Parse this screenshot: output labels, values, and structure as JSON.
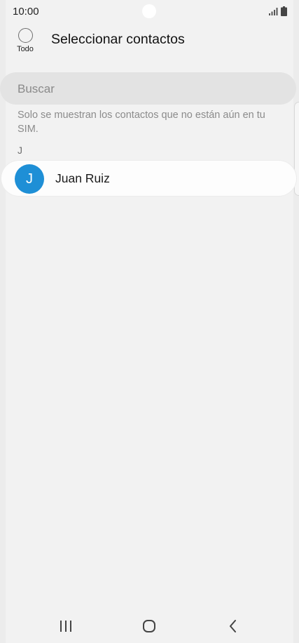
{
  "status_bar": {
    "time": "10:00",
    "icons": [
      "signal-icon",
      "battery-icon"
    ]
  },
  "header": {
    "select_all_label": "Todo",
    "title": "Seleccionar contactos"
  },
  "search": {
    "placeholder": "Buscar"
  },
  "info_text": "Solo se muestran los contactos que no están aún en tu SIM.",
  "sections": [
    {
      "letter": "J",
      "contacts": [
        {
          "initial": "J",
          "name": "Juan Ruiz",
          "avatar_color": "#1e8fd6"
        }
      ]
    }
  ],
  "nav_bar": {
    "icons": [
      "recents-icon",
      "home-icon",
      "back-icon"
    ]
  }
}
